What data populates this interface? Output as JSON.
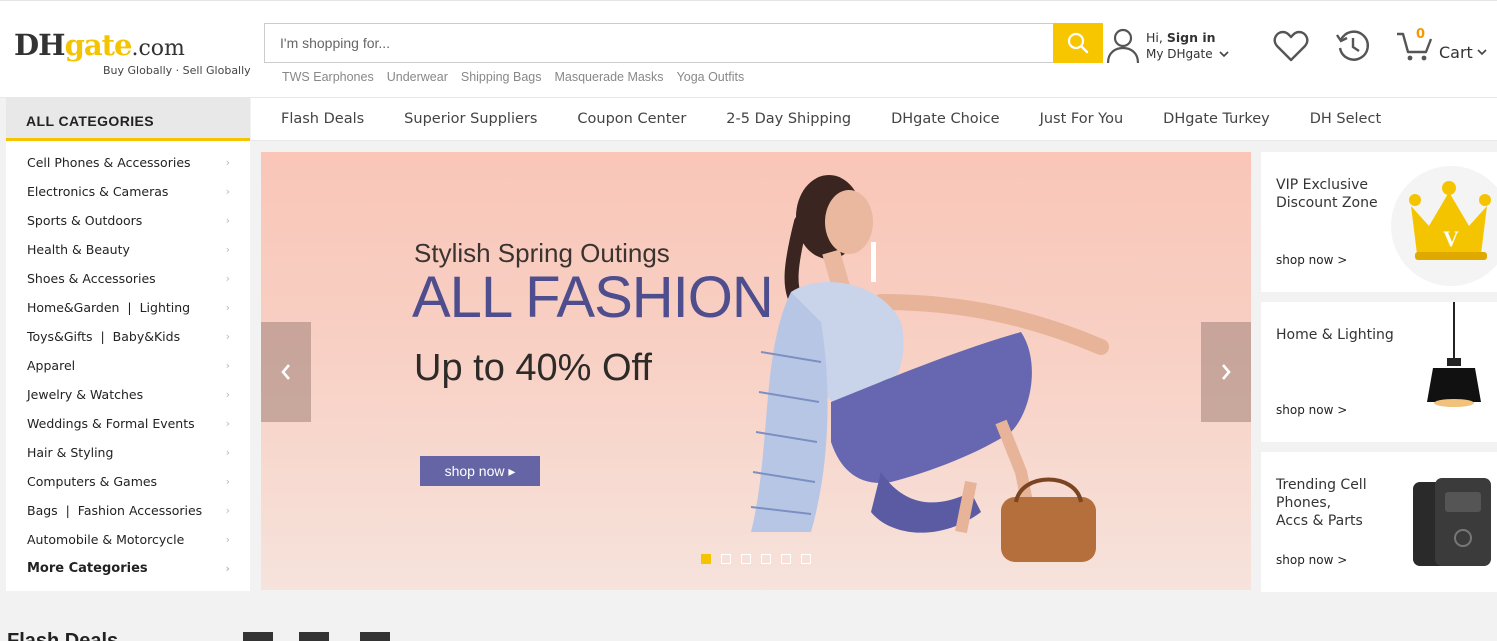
{
  "header": {
    "logo": {
      "brand_dh": "DH",
      "brand_gate": "gate",
      "brand_com": ".com",
      "tagline": "Buy Globally · Sell Globally"
    },
    "search": {
      "placeholder": "I'm shopping for...",
      "button_icon": "search-icon",
      "hot_terms": [
        "TWS Earphones",
        "Underwear",
        "Shipping Bags",
        "Masquerade Masks",
        "Yoga Outfits"
      ]
    },
    "account": {
      "greeting": "Hi,",
      "sign_in": "Sign in",
      "my": "My DHgate"
    },
    "cart": {
      "count": "0",
      "label": "Cart"
    }
  },
  "categories": {
    "title": "ALL CATEGORIES",
    "items": [
      "Cell Phones & Accessories",
      "Electronics & Cameras",
      "Sports & Outdoors",
      "Health & Beauty",
      "Shoes & Accessories",
      "Home&Garden  |  Lighting",
      "Toys&Gifts  |  Baby&Kids",
      "Apparel",
      "Jewelry & Watches",
      "Weddings & Formal Events",
      "Hair & Styling",
      "Computers & Games",
      "Bags  |  Fashion Accessories",
      "Automobile & Motorcycle",
      "More Categories"
    ],
    "arrow": "›"
  },
  "nav": [
    "Flash Deals",
    "Superior Suppliers",
    "Coupon Center",
    "2-5 Day Shipping",
    "DHgate Choice",
    "Just For You",
    "DHgate Turkey",
    "DH Select"
  ],
  "banner": {
    "subtitle": "Stylish Spring Outings",
    "title": "ALL FASHION",
    "offer": "Up to 40% Off",
    "cta": "shop now ▸",
    "slides": 6,
    "active_slide": 1
  },
  "promos": [
    {
      "title_l1": "VIP Exclusive",
      "title_l2": "Discount Zone",
      "link": "shop now >",
      "badge": "V"
    },
    {
      "title_l1": "Home & Lighting",
      "title_l2": "",
      "link": "shop now >"
    },
    {
      "title_l1": "Trending Cell",
      "title_l2": "Phones,",
      "title_l3": "Accs & Parts",
      "link": "shop now >"
    }
  ],
  "section": {
    "flash_title": "Flash Deals"
  },
  "colors": {
    "accent": "#f5c400",
    "cart_count": "#f39800",
    "banner_title": "#4e4e8e",
    "cta": "#6565a6"
  }
}
